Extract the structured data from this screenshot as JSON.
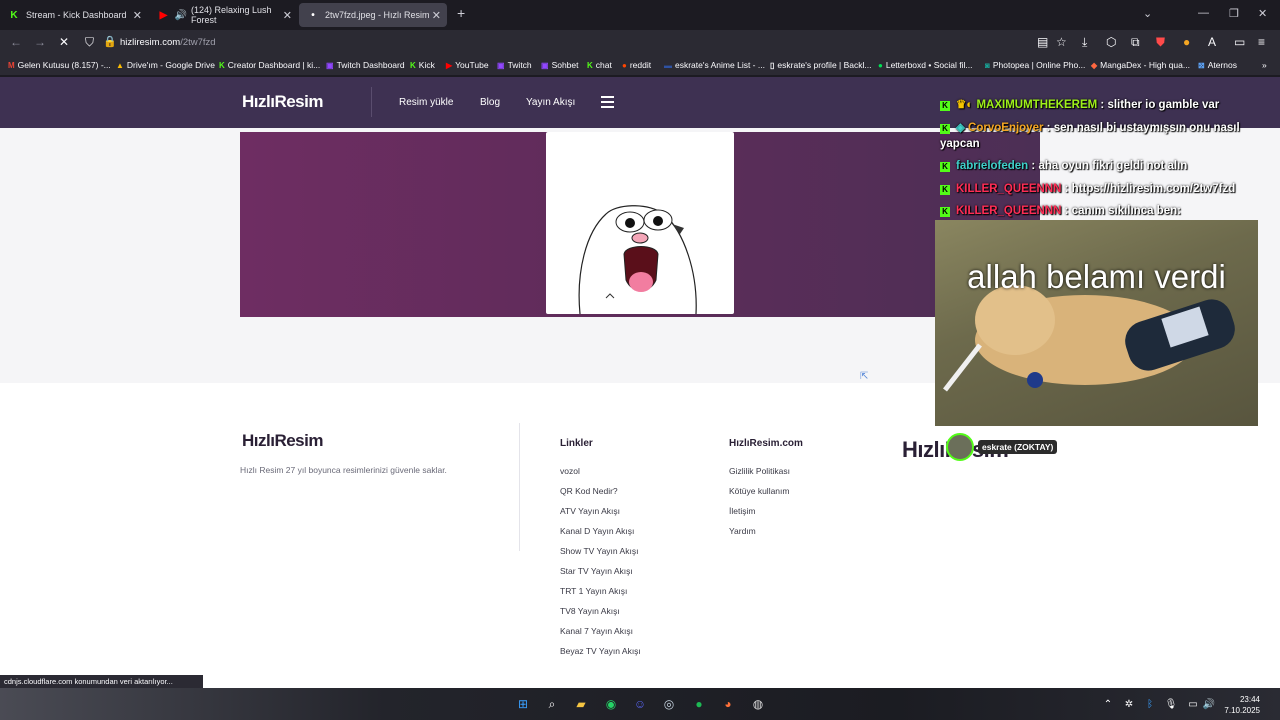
{
  "browser": {
    "tabs": [
      {
        "title": "Stream - Kick Dashboard",
        "icon": "kick-icon"
      },
      {
        "title": "(124) Relaxing Lush Forest",
        "icon": "youtube-icon"
      },
      {
        "title": "2tw7fzd.jpeg - Hızlı Resim",
        "icon": "dot-icon"
      }
    ],
    "url_host": "hizliresim.com",
    "url_path": "/2tw7fzd",
    "bookmarks": [
      "Gelen Kutusu (8.157) -...",
      "Drive'ım - Google Drive",
      "Creator Dashboard | ki...",
      "Twitch Dashboard",
      "Kick",
      "YouTube",
      "Twitch",
      "Sohbet",
      "chat",
      "reddit",
      "eskrate's Anime List - ...",
      "eskrate's profile | Backl...",
      "Letterboxd • Social fil...",
      "Photopea | Online Pho...",
      "MangaDex - High qua...",
      "Aternos"
    ],
    "status_text": "cdnjs.cloudflare.com konumundan veri aktarılıyor..."
  },
  "site": {
    "logo": "HızlıResim",
    "nav": [
      "Resim yükle",
      "Blog",
      "Yayın Akışı"
    ],
    "footer": {
      "tagline": "Hızlı Resim 27 yıl boyunca resimlerinizi güvenle saklar.",
      "col1_title": "Linkler",
      "col1_links": [
        "vozol",
        "QR Kod Nedir?",
        "ATV Yayın Akışı",
        "Kanal D Yayın Akışı",
        "Show TV Yayın Akışı",
        "Star TV Yayın Akışı",
        "TRT 1 Yayın Akışı",
        "TV8 Yayın Akışı",
        "Kanal 7 Yayın Akışı",
        "Beyaz TV Yayın Akışı"
      ],
      "col2_title": "HızlıResim.com",
      "col2_links": [
        "Gizlilik Politikası",
        "Kötüye kullanım",
        "İletişim",
        "Yardım"
      ]
    }
  },
  "stream_overlay": {
    "chat": [
      {
        "user": "MAXIMUMTHEKEREM",
        "msg": "slither io gamble var",
        "color": "#9ef01a"
      },
      {
        "user": "CorvoEnjoyer",
        "msg": "sen nasıl bi ustaymışsın onu nasıl",
        "msg2": "yapcan",
        "color": "#f5a623"
      },
      {
        "user": "fabrielofeden",
        "msg": "aha oyun fikri geldi not alın",
        "color": "#3fd0c9"
      },
      {
        "user": "KILLER_QUEENNN",
        "msg": "https://hizliresim.com/2tw7fzd",
        "color": "#ff2d55"
      },
      {
        "user": "KILLER_QUEENNN",
        "msg": "canım sıkılınca ben:",
        "color": "#ff2d55"
      }
    ],
    "meme_caption": "allah belamı verdi",
    "webcam_label": "eskrate (ZOKTAY)"
  },
  "taskbar": {
    "time": "23:44",
    "date": "7.10.2025"
  }
}
